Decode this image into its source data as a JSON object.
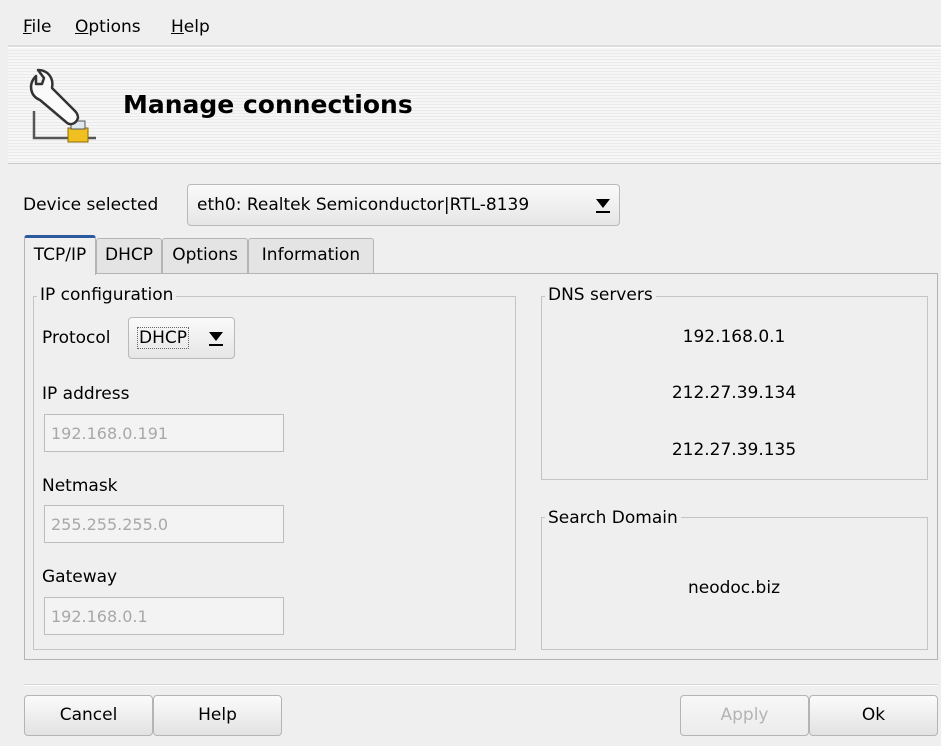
{
  "menu": {
    "file": {
      "mnemonic": "F",
      "rest": "ile"
    },
    "options": {
      "mnemonic": "O",
      "rest": "ptions"
    },
    "help": {
      "mnemonic": "H",
      "rest": "elp"
    }
  },
  "banner": {
    "title": "Manage connections",
    "icon": "wrench-network-icon"
  },
  "device": {
    "label": "Device selected",
    "value": "eth0: Realtek Semiconductor|RTL-8139"
  },
  "tabs": [
    {
      "label": "TCP/IP",
      "active": true
    },
    {
      "label": "DHCP",
      "active": false
    },
    {
      "label": "Options",
      "active": false
    },
    {
      "label": "Information",
      "active": false
    }
  ],
  "ip_config": {
    "title": "IP configuration",
    "protocol_label": "Protocol",
    "protocol_value": "DHCP",
    "ip_label": "IP address",
    "ip_value": "192.168.0.191",
    "netmask_label": "Netmask",
    "netmask_value": "255.255.255.0",
    "gateway_label": "Gateway",
    "gateway_value": "192.168.0.1"
  },
  "dns": {
    "title": "DNS servers",
    "servers": [
      "192.168.0.1",
      "212.27.39.134",
      "212.27.39.135"
    ]
  },
  "search_domain": {
    "title": "Search Domain",
    "value": "neodoc.biz"
  },
  "buttons": {
    "cancel": "Cancel",
    "help": "Help",
    "apply": "Apply",
    "ok": "Ok"
  },
  "colors": {
    "tab_accent": "#2c5aa0",
    "disabled_text": "#b4b4b4"
  }
}
